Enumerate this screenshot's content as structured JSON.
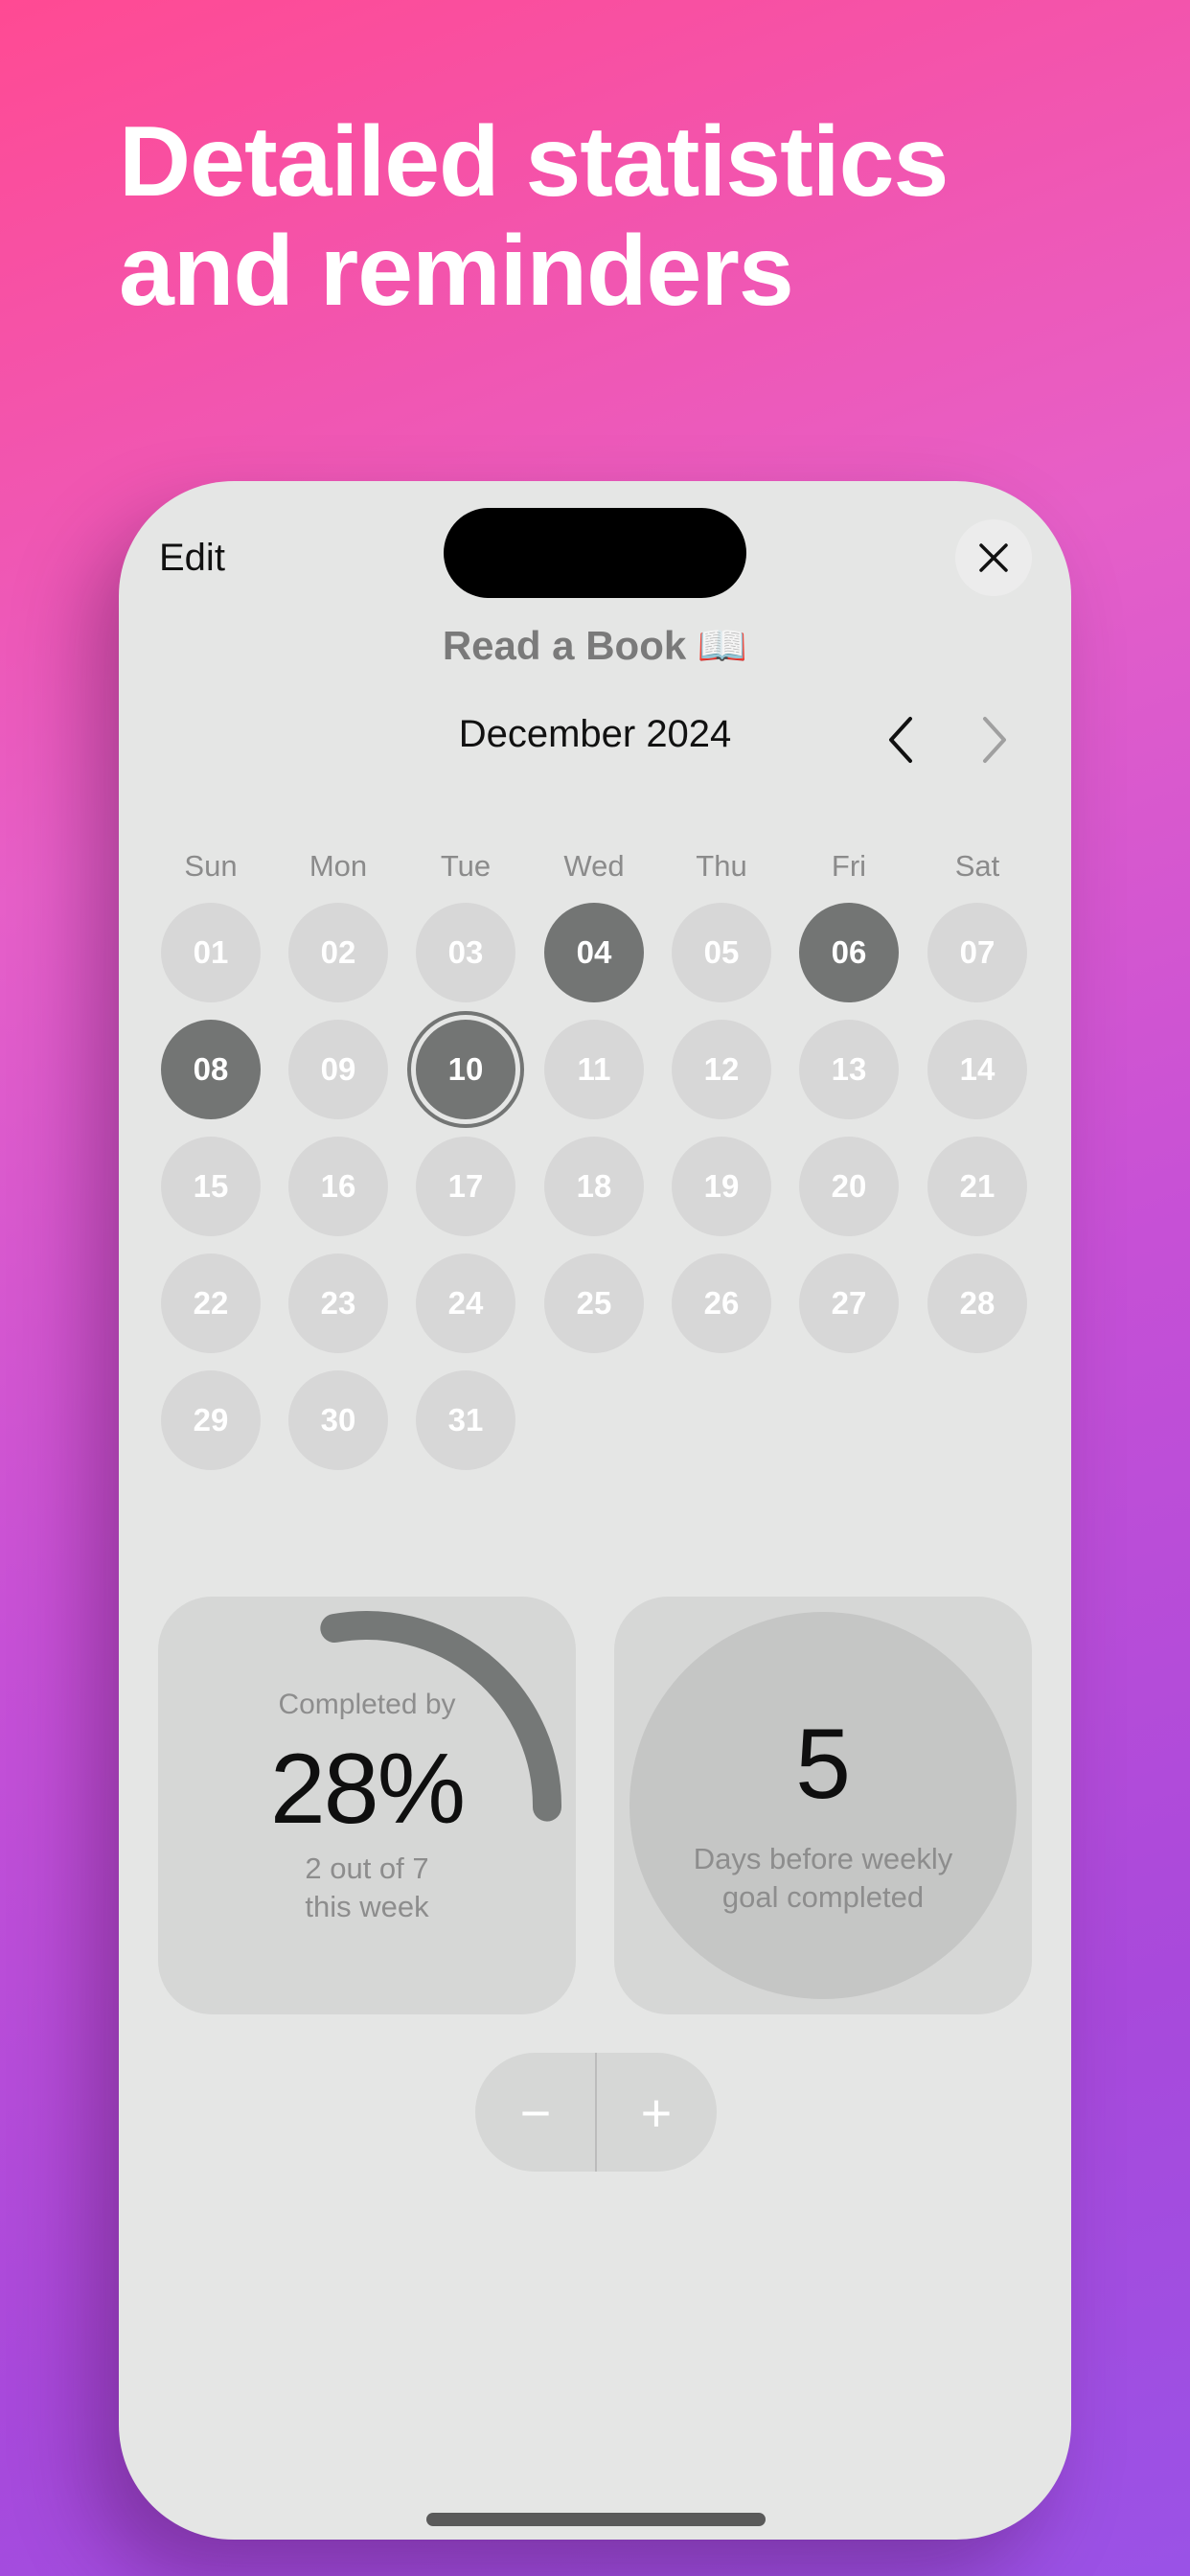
{
  "headline": [
    "Detailed statistics",
    "and reminders"
  ],
  "header": {
    "edit_label": "Edit",
    "close_icon": "close-icon",
    "habit_title": "Read a Book 📖"
  },
  "calendar": {
    "month_label": "December 2024",
    "prev_icon": "chevron-left-icon",
    "next_icon": "chevron-right-icon",
    "weekdays": [
      "Sun",
      "Mon",
      "Tue",
      "Wed",
      "Thu",
      "Fri",
      "Sat"
    ],
    "days": [
      {
        "label": "01",
        "state": "empty"
      },
      {
        "label": "02",
        "state": "empty"
      },
      {
        "label": "03",
        "state": "empty"
      },
      {
        "label": "04",
        "state": "done"
      },
      {
        "label": "05",
        "state": "empty"
      },
      {
        "label": "06",
        "state": "done"
      },
      {
        "label": "07",
        "state": "empty"
      },
      {
        "label": "08",
        "state": "done"
      },
      {
        "label": "09",
        "state": "empty"
      },
      {
        "label": "10",
        "state": "today"
      },
      {
        "label": "11",
        "state": "empty"
      },
      {
        "label": "12",
        "state": "empty"
      },
      {
        "label": "13",
        "state": "empty"
      },
      {
        "label": "14",
        "state": "empty"
      },
      {
        "label": "15",
        "state": "empty"
      },
      {
        "label": "16",
        "state": "empty"
      },
      {
        "label": "17",
        "state": "empty"
      },
      {
        "label": "18",
        "state": "empty"
      },
      {
        "label": "19",
        "state": "empty"
      },
      {
        "label": "20",
        "state": "empty"
      },
      {
        "label": "21",
        "state": "empty"
      },
      {
        "label": "22",
        "state": "empty"
      },
      {
        "label": "23",
        "state": "empty"
      },
      {
        "label": "24",
        "state": "empty"
      },
      {
        "label": "25",
        "state": "empty"
      },
      {
        "label": "26",
        "state": "empty"
      },
      {
        "label": "27",
        "state": "empty"
      },
      {
        "label": "28",
        "state": "empty"
      },
      {
        "label": "29",
        "state": "empty"
      },
      {
        "label": "30",
        "state": "empty"
      },
      {
        "label": "31",
        "state": "empty"
      }
    ]
  },
  "completion": {
    "label": "Completed by",
    "percent_text": "28%",
    "progress_fraction": 0.28,
    "line1": "2 out of 7",
    "line2": "this week"
  },
  "goal": {
    "days_value": "5",
    "line1": "Days before weekly",
    "line2": "goal completed"
  },
  "stepper": {
    "minus_label": "−",
    "plus_label": "+"
  },
  "colors": {
    "done": "#737574",
    "empty": "#d7d7d7",
    "ring": "#757877"
  }
}
